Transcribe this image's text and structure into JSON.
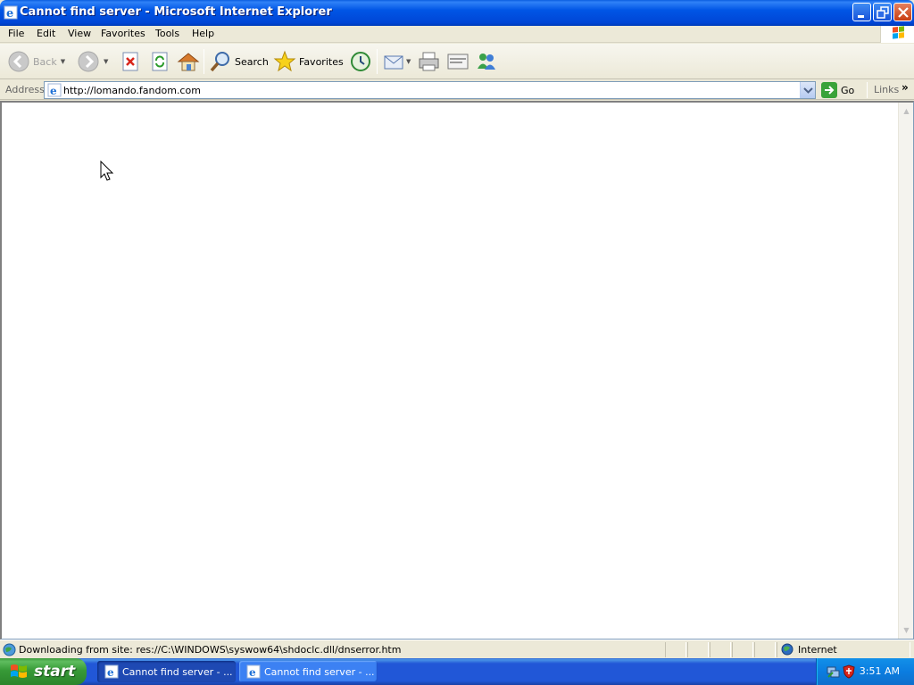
{
  "window": {
    "title": "Cannot find server - Microsoft Internet Explorer"
  },
  "menu": {
    "items": [
      "File",
      "Edit",
      "View",
      "Favorites",
      "Tools",
      "Help"
    ]
  },
  "toolbar": {
    "back_label": "Back",
    "search_label": "Search",
    "favorites_label": "Favorites"
  },
  "address": {
    "label": "Address",
    "url": "http://lomando.fandom.com",
    "go_label": "Go",
    "links_label": "Links"
  },
  "status": {
    "text": "Downloading from site: res://C:\\WINDOWS\\syswow64\\shdoclc.dll/dnserror.htm",
    "zone": "Internet"
  },
  "taskbar": {
    "start_label": "start",
    "tasks": [
      {
        "label": "Cannot find server - ...",
        "active": true
      },
      {
        "label": "Cannot find server - ...",
        "active": false
      }
    ],
    "clock": "3:51 AM"
  }
}
